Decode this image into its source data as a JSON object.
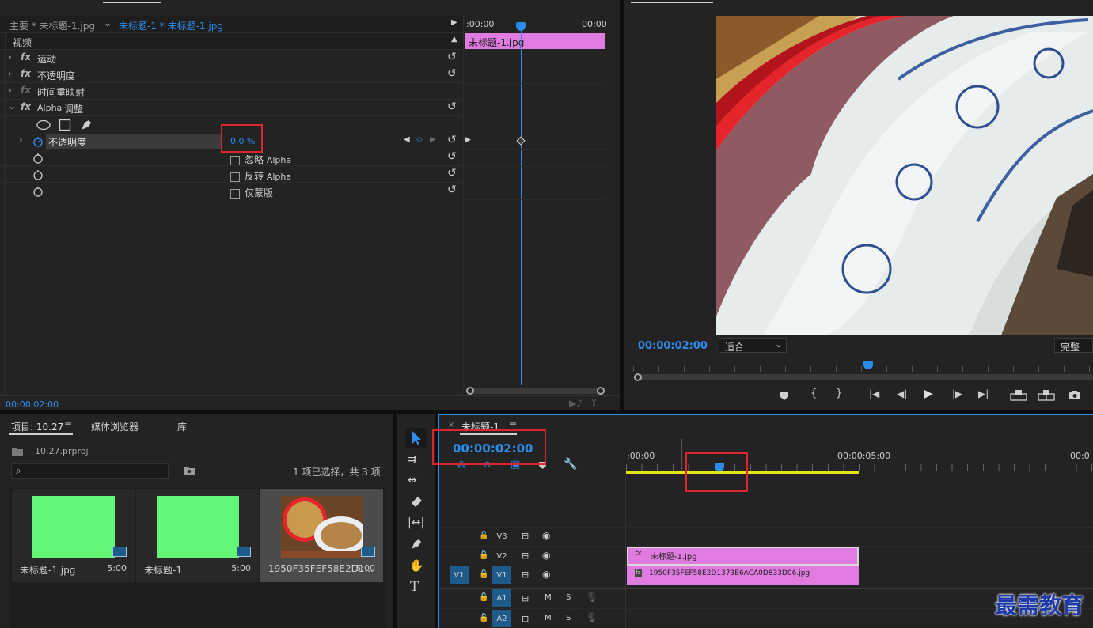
{
  "effects": {
    "tab_master": "主要 * 未标题-1.jpg",
    "tab_clip": "未标题-1 * 未标题-1.jpg",
    "tl_start": ":00:00",
    "tl_end": "00:00",
    "clip_label": "未标题-1.jpg",
    "section_video": "视频",
    "items": {
      "motion": "运动",
      "opacity": "不透明度",
      "time_remap": "时间重映射",
      "alpha_adjust_prefix": "Alpha",
      "alpha_adjust": "调整"
    },
    "param_opacity_label": "不透明度",
    "param_opacity_value": "0.0 %",
    "ignore_alpha_a": "忽略",
    "ignore_alpha_b": "Alpha",
    "invert_alpha_a": "反转",
    "invert_alpha_b": "Alpha",
    "mask_only": "仅蒙版",
    "timecode": "00:00:02:00"
  },
  "program": {
    "timecode": "00:00:02:00",
    "fit": "适合",
    "quality": "完整"
  },
  "project": {
    "tab_project": "项目: 10.27",
    "tab_media_browser": "媒体浏览器",
    "tab_library": "库",
    "file_name": "10.27.prproj",
    "selection_status": "1 项已选择，共 3 项",
    "search_placeholder": "",
    "items": [
      {
        "name": "未标题-1.jpg",
        "duration": "5:00"
      },
      {
        "name": "未标题-1",
        "duration": "5:00"
      },
      {
        "name": "1950F35FEF58E2D1...",
        "duration": "5:00"
      }
    ]
  },
  "timeline": {
    "tab": "未标题-1",
    "timecode": "00:00:02:00",
    "ruler_start": ":00:00",
    "ruler_mid": "00:00:05:00",
    "ruler_end": "00:0",
    "tracks": {
      "v3": "V3",
      "v2": "V2",
      "v1": "V1",
      "v1_src": "V1",
      "a1": "A1",
      "a1_src": "A1",
      "a2": "A2",
      "a2_src": "A2",
      "m": "M",
      "s": "S"
    },
    "clip_v2": "未标题-1.jpg",
    "clip_v1": "1950F35FEF58E2D1373E6ACA0D833D06.jpg"
  },
  "watermark": "最需教育",
  "colors": {
    "accent_blue": "#2d8ceb",
    "clip_pink": "#e07be0",
    "highlight_red": "#e0242d",
    "thumb_green": "#63f676",
    "workarea_yellow": "#e4e417"
  }
}
